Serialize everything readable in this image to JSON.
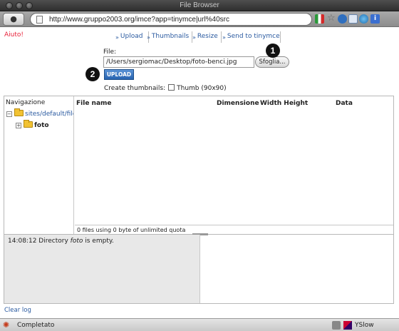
{
  "window": {
    "title": "File Browser"
  },
  "toolbar": {
    "url": "http://www.gruppo2003.org/imce?app=tinymce|url%40src",
    "extension_icons": [
      "flag-italy-icon",
      "star-icon",
      "feed-icon",
      "mail-icon",
      "globe-icon",
      "info-icon"
    ]
  },
  "help_link": "Aiuto!",
  "tabs": [
    {
      "label": "Upload"
    },
    {
      "label": "Thumbnails"
    },
    {
      "label": "Resize"
    },
    {
      "label": "Send to tinymce"
    }
  ],
  "upload": {
    "file_label": "File:",
    "file_value": "/Users/sergiomac/Desktop/foto-benci.jpg",
    "browse_label": "Sfoglia...",
    "upload_label": "UPLOAD",
    "thumbnails_label": "Create thumbnails:",
    "thumb_option": "Thumb (90x90)",
    "thumb_checked": false,
    "badges": [
      "1",
      "2"
    ]
  },
  "navigation": {
    "title": "Navigazione",
    "tree": [
      {
        "label": "sites/default/files",
        "expander": "−",
        "level": 0
      },
      {
        "label": "foto",
        "expander": "+",
        "level": 1
      }
    ]
  },
  "file_list": {
    "columns": [
      "File name",
      "Dimensione",
      "Width Height",
      "Data"
    ],
    "rows": [],
    "quota_status": "0 files using 0 byte of unlimited quota"
  },
  "log": {
    "time": "14:08:12",
    "message_pre": "Directory",
    "message_dir": "foto",
    "message_post": "is empty."
  },
  "clear_log": "Clear log",
  "statusbar": {
    "status": "Completato",
    "addon": "YSlow"
  },
  "colors": {
    "help_link": "#e8223a",
    "link": "#2a5aa0",
    "upload_button": "#2763b0",
    "folder": "#f2c232"
  }
}
